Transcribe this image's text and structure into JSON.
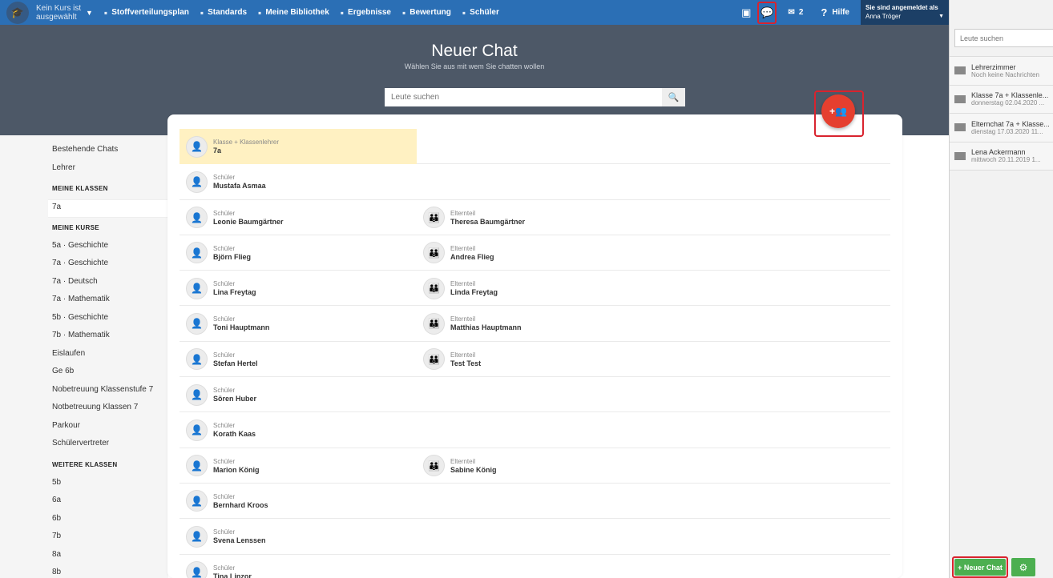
{
  "topnav": {
    "course_selector": "Kein Kurs ist ausgewählt",
    "items": [
      {
        "label": "Stoffverteilungsplan",
        "icon": "list-icon"
      },
      {
        "label": "Standards",
        "icon": "shield-icon"
      },
      {
        "label": "Meine Bibliothek",
        "icon": "library-icon"
      },
      {
        "label": "Ergebnisse",
        "icon": "bar-chart-icon"
      },
      {
        "label": "Bewertung",
        "icon": "rating-icon"
      },
      {
        "label": "Schüler",
        "icon": "students-icon"
      }
    ],
    "mail_count": "2",
    "help_label": "Hilfe",
    "user_header": "Sie sind angemeldet als",
    "user_name": "Anna Tröger"
  },
  "banner": {
    "title": "Neuer Chat",
    "subtitle": "Wählen Sie aus mit wem Sie chatten wollen",
    "search_placeholder": "Leute suchen"
  },
  "leftnav": {
    "top_items": [
      "Bestehende Chats",
      "Lehrer"
    ],
    "sections": [
      {
        "title": "MEINE KLASSEN",
        "items": [
          "7a"
        ]
      },
      {
        "title": "MEINE KURSE",
        "items": [
          "5a · Geschichte",
          "7a · Geschichte",
          "7a · Deutsch",
          "7a · Mathematik",
          "5b · Geschichte",
          "7b · Mathematik",
          "Eislaufen",
          "Ge 6b",
          "Nobetreuung Klassenstufe 7",
          "Notbetreuung Klassen 7",
          "Parkour",
          "Schülervertreter"
        ]
      },
      {
        "title": "WEITERE KLASSEN",
        "items": [
          "5b",
          "6a",
          "6b",
          "7b",
          "8a",
          "8b"
        ]
      }
    ]
  },
  "people": [
    {
      "left": {
        "role": "Klasse + Klassenlehrer",
        "name": "7a",
        "type": "class"
      },
      "right": null
    },
    {
      "left": {
        "role": "Schüler",
        "name": "Mustafa Asmaa"
      },
      "right": null
    },
    {
      "left": {
        "role": "Schüler",
        "name": "Leonie Baumgärtner"
      },
      "right": {
        "role": "Elternteil",
        "name": "Theresa Baumgärtner"
      }
    },
    {
      "left": {
        "role": "Schüler",
        "name": "Björn Flieg"
      },
      "right": {
        "role": "Elternteil",
        "name": "Andrea Flieg"
      }
    },
    {
      "left": {
        "role": "Schüler",
        "name": "Lina Freytag"
      },
      "right": {
        "role": "Elternteil",
        "name": "Linda Freytag"
      }
    },
    {
      "left": {
        "role": "Schüler",
        "name": "Toni Hauptmann"
      },
      "right": {
        "role": "Elternteil",
        "name": "Matthias Hauptmann"
      }
    },
    {
      "left": {
        "role": "Schüler",
        "name": "Stefan Hertel"
      },
      "right": {
        "role": "Elternteil",
        "name": "Test Test"
      }
    },
    {
      "left": {
        "role": "Schüler",
        "name": "Sören Huber"
      },
      "right": null
    },
    {
      "left": {
        "role": "Schüler",
        "name": "Korath Kaas"
      },
      "right": null
    },
    {
      "left": {
        "role": "Schüler",
        "name": "Marion König"
      },
      "right": {
        "role": "Elternteil",
        "name": "Sabine König"
      }
    },
    {
      "left": {
        "role": "Schüler",
        "name": "Bernhard Kroos"
      },
      "right": null
    },
    {
      "left": {
        "role": "Schüler",
        "name": "Svena Lenssen"
      },
      "right": null
    },
    {
      "left": {
        "role": "Schüler",
        "name": "Tina Linzor"
      },
      "right": null
    }
  ],
  "rightpanel": {
    "search_placeholder": "Leute suchen",
    "chats": [
      {
        "title": "Lehrerzimmer",
        "sub": "Noch keine Nachrichten"
      },
      {
        "title": "Klasse 7a + Klassenle...",
        "sub": "donnerstag 02.04.2020 ..."
      },
      {
        "title": "Elternchat 7a + Klasse...",
        "sub": "dienstag 17.03.2020 11..."
      },
      {
        "title": "Lena Ackermann",
        "sub": "mittwoch 20.11.2019 1..."
      }
    ],
    "new_chat_label": "+ Neuer Chat"
  }
}
